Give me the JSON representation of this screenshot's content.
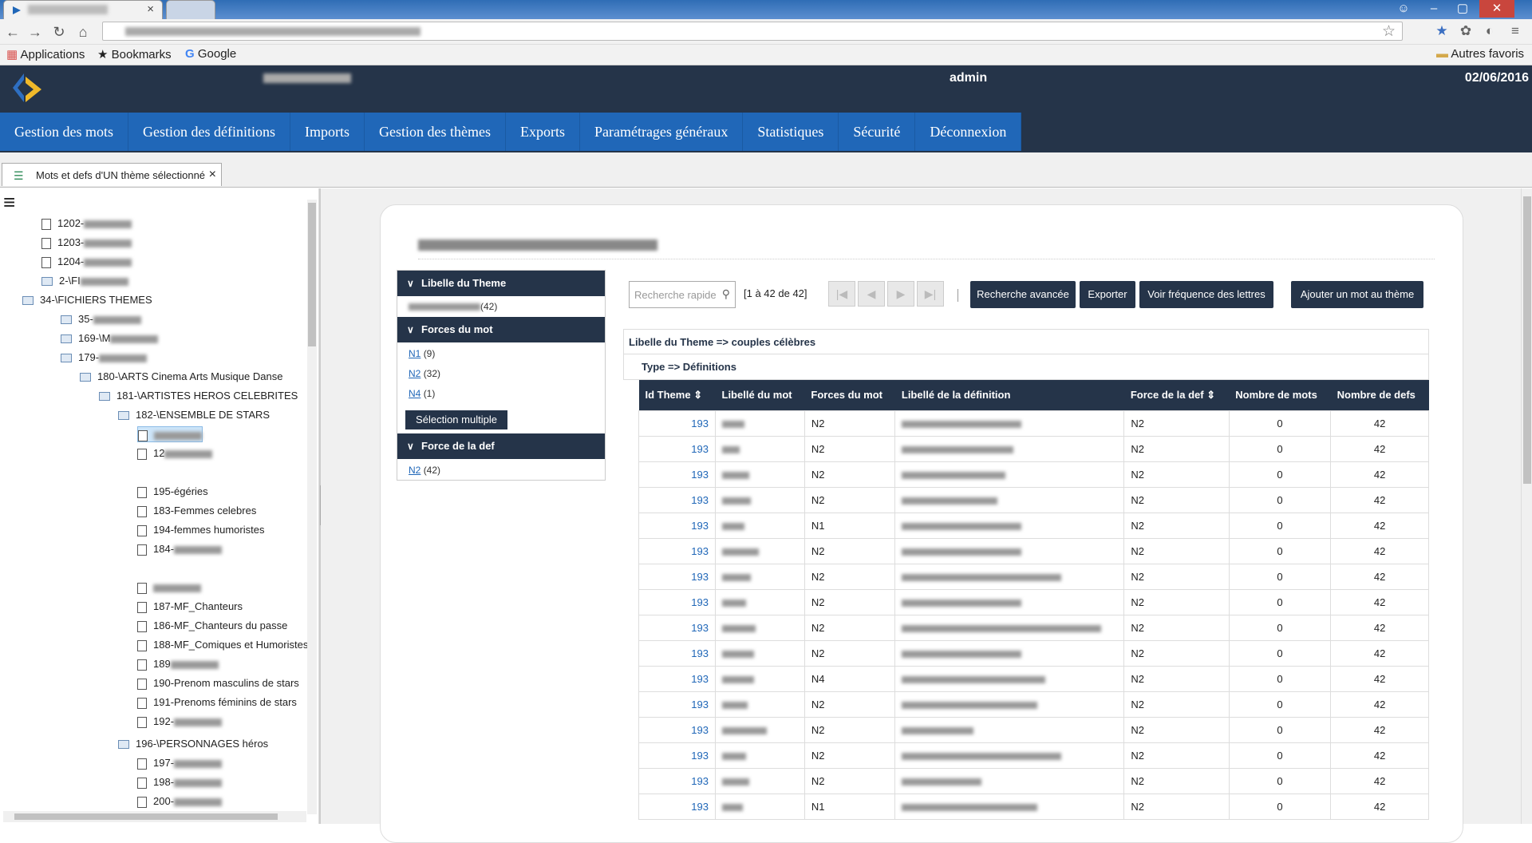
{
  "browser": {
    "bookmarks": [
      "Applications",
      "Bookmarks",
      "Google"
    ],
    "other_bookmarks": "Autres favoris"
  },
  "header": {
    "user": "admin",
    "date": "02/06/2016",
    "menu": [
      "Gestion des mots",
      "Gestion des définitions",
      "Imports",
      "Gestion des thèmes",
      "Exports",
      "Paramétrages généraux",
      "Statistiques",
      "Sécurité",
      "Déconnexion"
    ]
  },
  "page_tab": "Mots et defs d'UN thème sélectionné",
  "tree": [
    {
      "label": "1202-",
      "indent": 1,
      "kind": "doc",
      "blur": true
    },
    {
      "label": "1203-",
      "indent": 1,
      "kind": "doc",
      "blur": true
    },
    {
      "label": "1204-",
      "indent": 1,
      "kind": "doc",
      "blur": true
    },
    {
      "label": "2-\\FI",
      "indent": 1,
      "kind": "folder",
      "blur": true
    },
    {
      "label": "34-\\FICHIERS THEMES",
      "indent": 0,
      "kind": "folder"
    },
    {
      "label": "35-",
      "indent": 2,
      "kind": "folder",
      "blur": true
    },
    {
      "label": "169-\\M",
      "indent": 2,
      "kind": "folder",
      "blur": true
    },
    {
      "label": "179-",
      "indent": 2,
      "kind": "folder",
      "blur": true
    },
    {
      "label": "180-\\ARTS Cinema Arts Musique Danse",
      "indent": 3,
      "kind": "folder"
    },
    {
      "label": "181-\\ARTISTES HEROS CELEBRITES",
      "indent": 4,
      "kind": "folder"
    },
    {
      "label": "182-\\ENSEMBLE DE STARS",
      "indent": 5,
      "kind": "folder"
    },
    {
      "label": "",
      "indent": 6,
      "kind": "doc",
      "blur": true,
      "selected": true
    },
    {
      "label": "12",
      "indent": 6,
      "kind": "doc",
      "blur": true
    },
    {
      "label": "195-égéries",
      "indent": 6,
      "kind": "doc"
    },
    {
      "label": "183-Femmes celebres",
      "indent": 6,
      "kind": "doc"
    },
    {
      "label": "194-femmes humoristes",
      "indent": 6,
      "kind": "doc"
    },
    {
      "label": "184-",
      "indent": 6,
      "kind": "doc",
      "blur": true
    },
    {
      "label": "",
      "indent": 6,
      "kind": "doc",
      "blur": true
    },
    {
      "label": "187-MF_Chanteurs",
      "indent": 6,
      "kind": "doc"
    },
    {
      "label": "186-MF_Chanteurs du passe",
      "indent": 6,
      "kind": "doc"
    },
    {
      "label": "188-MF_Comiques et Humoristes",
      "indent": 6,
      "kind": "doc"
    },
    {
      "label": "189",
      "indent": 6,
      "kind": "doc",
      "blur": true
    },
    {
      "label": "190-Prenom masculins de stars",
      "indent": 6,
      "kind": "doc"
    },
    {
      "label": "191-Prenoms féminins de stars",
      "indent": 6,
      "kind": "doc"
    },
    {
      "label": "192-",
      "indent": 6,
      "kind": "doc",
      "blur": true
    },
    {
      "label": "196-\\PERSONNAGES héros",
      "indent": 5,
      "kind": "folder"
    },
    {
      "label": "197-",
      "indent": 6,
      "kind": "doc",
      "blur": true
    },
    {
      "label": "198-",
      "indent": 6,
      "kind": "doc",
      "blur": true
    },
    {
      "label": "200-",
      "indent": 6,
      "kind": "doc",
      "blur": true
    }
  ],
  "facets": {
    "theme_header": "Libelle du Theme",
    "theme_count": "(42)",
    "forces_header": "Forces du mot",
    "forces": [
      {
        "label": "N1",
        "count": "(9)"
      },
      {
        "label": "N2",
        "count": "(32)"
      },
      {
        "label": "N4",
        "count": "(1)"
      }
    ],
    "multi_select": "Sélection multiple",
    "def_header": "Force de la def",
    "def_values": [
      {
        "label": "N2",
        "count": "(42)"
      }
    ]
  },
  "toolbar": {
    "search_placeholder": "Recherche rapide",
    "page_info": "[1 à 42 de 42]",
    "advanced": "Recherche avancée",
    "export": "Exporter",
    "freq": "Voir fréquence des lettres",
    "add": "Ajouter un mot au thème"
  },
  "grid": {
    "group1": "Libelle du Theme => couples célèbres",
    "group2": "Type => Définitions",
    "columns": [
      "Id Theme",
      "Libellé du mot",
      "Forces du mot",
      "Libellé de la définition",
      "Force de la def",
      "Nombre de mots",
      "Nombre de defs"
    ],
    "rows": [
      {
        "id": "193",
        "force": "N2",
        "fdef": "N2",
        "nmots": "0",
        "ndefs": "42"
      },
      {
        "id": "193",
        "force": "N2",
        "fdef": "N2",
        "nmots": "0",
        "ndefs": "42"
      },
      {
        "id": "193",
        "force": "N2",
        "fdef": "N2",
        "nmots": "0",
        "ndefs": "42"
      },
      {
        "id": "193",
        "force": "N2",
        "fdef": "N2",
        "nmots": "0",
        "ndefs": "42"
      },
      {
        "id": "193",
        "force": "N1",
        "fdef": "N2",
        "nmots": "0",
        "ndefs": "42"
      },
      {
        "id": "193",
        "force": "N2",
        "fdef": "N2",
        "nmots": "0",
        "ndefs": "42"
      },
      {
        "id": "193",
        "force": "N2",
        "fdef": "N2",
        "nmots": "0",
        "ndefs": "42"
      },
      {
        "id": "193",
        "force": "N2",
        "fdef": "N2",
        "nmots": "0",
        "ndefs": "42"
      },
      {
        "id": "193",
        "force": "N2",
        "fdef": "N2",
        "nmots": "0",
        "ndefs": "42"
      },
      {
        "id": "193",
        "force": "N2",
        "fdef": "N2",
        "nmots": "0",
        "ndefs": "42"
      },
      {
        "id": "193",
        "force": "N4",
        "fdef": "N2",
        "nmots": "0",
        "ndefs": "42"
      },
      {
        "id": "193",
        "force": "N2",
        "fdef": "N2",
        "nmots": "0",
        "ndefs": "42"
      },
      {
        "id": "193",
        "force": "N2",
        "fdef": "N2",
        "nmots": "0",
        "ndefs": "42"
      },
      {
        "id": "193",
        "force": "N2",
        "fdef": "N2",
        "nmots": "0",
        "ndefs": "42"
      },
      {
        "id": "193",
        "force": "N2",
        "fdef": "N2",
        "nmots": "0",
        "ndefs": "42"
      },
      {
        "id": "193",
        "force": "N1",
        "fdef": "N2",
        "nmots": "0",
        "ndefs": "42"
      }
    ]
  }
}
